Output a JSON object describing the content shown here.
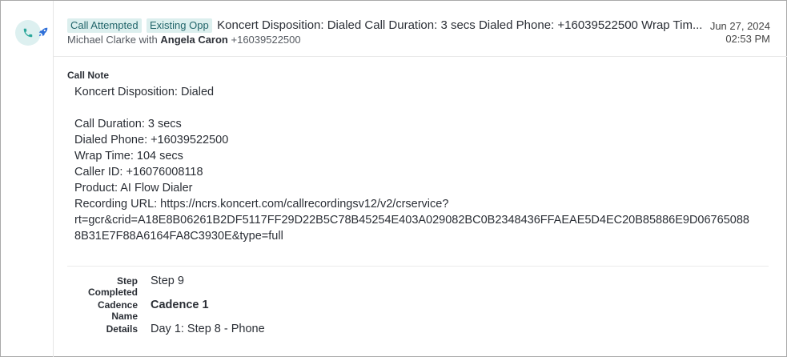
{
  "activity": {
    "icons": {
      "primary": "phone-icon",
      "secondary": "rocket-icon"
    },
    "tags": [
      "Call Attempted",
      "Existing Opp"
    ],
    "title": "Koncert Disposition: Dialed Call Duration: 3 secs Dialed Phone: +16039522500 Wrap Tim...",
    "rep": "Michael Clarke",
    "with_text": "with",
    "contact": "Angela Caron",
    "contact_phone": "+16039522500",
    "date": "Jun 27, 2024",
    "time": "02:53 PM"
  },
  "call_note": {
    "label": "Call Note",
    "disposition": "Koncert Disposition: Dialed",
    "duration": "Call Duration: 3 secs",
    "dialed_phone": "Dialed Phone: +16039522500",
    "wrap_time": "Wrap Time: 104 secs",
    "caller_id": "Caller ID: +16076008118",
    "product": "Product: AI Flow Dialer",
    "recording_url_line1": "Recording URL: https://ncrs.koncert.com/callrecordingsv12/v2/crservice?",
    "recording_url_line2": "rt=gcr&crid=A18E8B06261B2DF5117FF29D22B5C78B45254E403A029082BC0B2348436FFAEAE5D4EC20B85886E9D06765088",
    "recording_url_line3": "8B31E7F88A6164FA8C3930E&type=full"
  },
  "details": {
    "step_completed": {
      "label_line1": "Step",
      "label_line2": "Completed",
      "value": "Step 9"
    },
    "cadence_name": {
      "label_line1": "Cadence",
      "label_line2": "Name",
      "value": "Cadence 1"
    },
    "details": {
      "label": "Details",
      "value": "Day 1: Step 8 - Phone"
    }
  },
  "colors": {
    "tag_bg": "#dcefee",
    "tag_text": "#22656a",
    "icon_bg": "#ddf0f0",
    "phone": "#2aa79b",
    "rocket": "#2f6fd8"
  }
}
